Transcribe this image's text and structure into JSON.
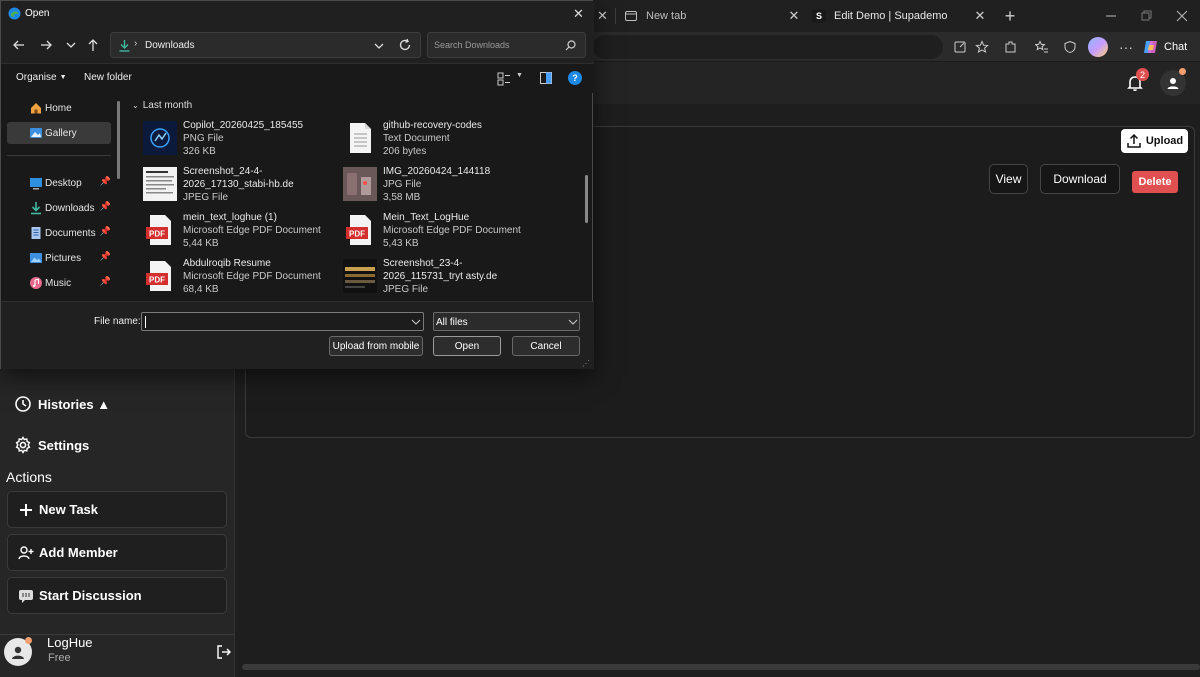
{
  "browser": {
    "tabs": [
      {
        "label": "New tab"
      },
      {
        "label": "Edit Demo | Supademo",
        "favicon_letter": "S"
      }
    ],
    "chat_label": "Chat",
    "notification_count": "2"
  },
  "app": {
    "upload_label": "Upload",
    "view_label": "View",
    "download_label": "Download",
    "delete_label": "Delete",
    "delete_color": "#e05050",
    "nav": {
      "histories_label": "Histories ▲",
      "settings_label": "Settings"
    },
    "actions_heading": "Actions",
    "actions": [
      {
        "label": "New Task",
        "icon": "plus-icon"
      },
      {
        "label": "Add Member",
        "icon": "add-user-icon"
      },
      {
        "label": "Start Discussion",
        "icon": "chat-bubble-icon"
      }
    ],
    "user": {
      "name": "LogHue",
      "plan": "Free"
    }
  },
  "dialog": {
    "title": "Open",
    "breadcrumb": "Downloads",
    "search_placeholder": "Search Downloads",
    "organise_label": "Organise",
    "new_folder_label": "New folder",
    "left_nav": [
      {
        "label": "Home",
        "icon": "home-icon"
      },
      {
        "label": "Gallery",
        "icon": "gallery-icon"
      },
      {
        "label": "Desktop",
        "icon": "desktop-icon"
      },
      {
        "label": "Downloads",
        "icon": "download-icon"
      },
      {
        "label": "Documents",
        "icon": "documents-icon"
      },
      {
        "label": "Pictures",
        "icon": "pictures-icon"
      },
      {
        "label": "Music",
        "icon": "music-icon"
      }
    ],
    "group_label": "Last month",
    "files": [
      {
        "name": "Copilot_20260425_185455",
        "type": "PNG File",
        "size": "326 KB"
      },
      {
        "name": "github-recovery-codes",
        "type": "Text Document",
        "size": "206 bytes"
      },
      {
        "name": "Screenshot_24-4-2026_17130_stabi-hb.de",
        "type": "JPEG File",
        "size": ""
      },
      {
        "name": "IMG_20260424_144118",
        "type": "JPG File",
        "size": "3,58 MB"
      },
      {
        "name": "mein_text_loghue (1)",
        "type": "Microsoft Edge PDF Document",
        "size": "5,44 KB"
      },
      {
        "name": "Mein_Text_LogHue",
        "type": "Microsoft Edge PDF Document",
        "size": "5,43 KB"
      },
      {
        "name": "Abdulroqib Resume",
        "type": "Microsoft Edge PDF Document",
        "size": "68,4 KB"
      },
      {
        "name": "Screenshot_23-4-2026_115731_tryt asty.de",
        "type": "JPEG File",
        "size": ""
      }
    ],
    "file_name_label": "File name:",
    "file_name_value": "",
    "file_type_value": "All files",
    "upload_mobile_label": "Upload from mobile",
    "open_label": "Open",
    "cancel_label": "Cancel",
    "pdf_label": "PDF"
  }
}
